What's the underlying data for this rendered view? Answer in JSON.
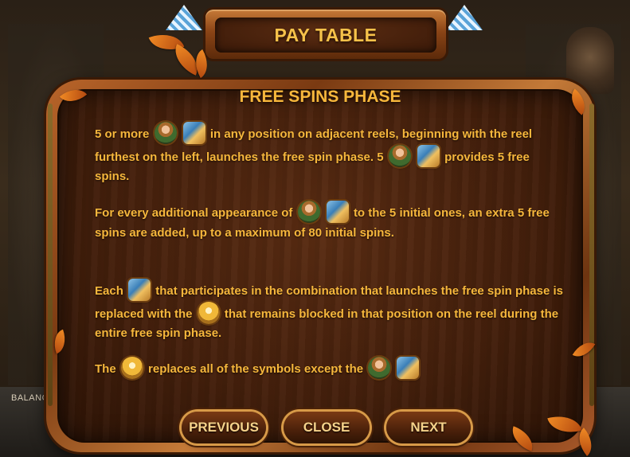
{
  "background": {
    "balance_label": "BALANC"
  },
  "paytable": {
    "title": "PAY TABLE",
    "section_title": "FREE SPINS PHASE",
    "paragraphs": {
      "p1_a": "5 or more",
      "p1_b": "in any position on adjacent reels, beginning with the reel furthest on the left, launches the free spin phase. 5",
      "p1_c": "provides 5 free spins.",
      "p2_a": "For every additional appearance of",
      "p2_b": "to the 5 initial ones, an extra 5 free spins are added, up to a maximum of 80 initial spins.",
      "p3_a": "Each",
      "p3_b": "that participates in the combination that launches the free spin phase is replaced with the",
      "p3_c": "that remains blocked in that position on the reel during the entire free spin phase.",
      "p4_a": "The",
      "p4_b": "replaces all of the symbols except the"
    },
    "icons": {
      "scatter_girl": "girl-symbol-icon",
      "scatter_bottles": "bottles-symbol-icon",
      "wild_beer": "beer-mugs-symbol-icon"
    }
  },
  "buttons": {
    "previous": "PREVIOUS",
    "close": "CLOSE",
    "next": "NEXT"
  },
  "colors": {
    "text_gold": "#f6b73c",
    "title_gold": "#f6c24a",
    "panel_wood": "#45200c",
    "frame_copper": "#b9652a"
  }
}
